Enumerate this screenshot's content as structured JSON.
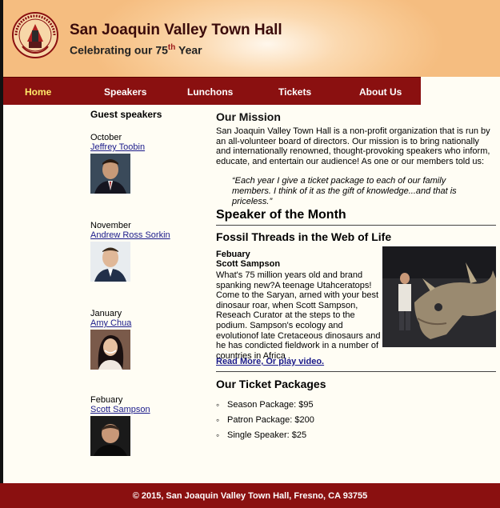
{
  "header": {
    "title": "San Joaquin Valley Town Hall",
    "tagline_prefix": "Celebrating our 75",
    "tagline_sup": "th",
    "tagline_suffix": " Year"
  },
  "nav": {
    "items": [
      "Home",
      "Speakers",
      "Lunchons",
      "Tickets",
      "About Us"
    ],
    "active": "Home"
  },
  "sidebar": {
    "title": "Guest speakers",
    "speakers": [
      {
        "month": "October",
        "name": "Jeffrey Toobin"
      },
      {
        "month": "November",
        "name": "Andrew Ross Sorkin"
      },
      {
        "month": "January",
        "name": "Amy Chua"
      },
      {
        "month": "Febuary",
        "name": "Scott Sampson"
      }
    ]
  },
  "main": {
    "mission_title": "Our Mission",
    "mission_text": "San Joaquin Valley Town Hall is a non-profit organization that is run by an all-volunteer board of directors. Our mission is to bring nationally and internationally renowned, thought-provoking speakers who inform, educate, and entertain our audience! As one or our members told us:",
    "quote": "“Each year I give a ticket package to each of our family members. I think of it as the gift of knowledge...and that is priceless.”",
    "som_title": "Speaker of the Month",
    "feature_title": "Fossil Threads in the Web of Life",
    "feature_month": "Febuary",
    "feature_name": "Scott Sampson",
    "feature_text": "What's 75 million years old and brand spanking new?A teenage Utahceratops! Come to the Saryan, arned with your best dinosaur roar, when Scott Sampson, Reseach Curator at the steps to the podium. Sampson's ecology and evolutionof late Cretaceous dinosaurs and he has condicted fieldwork in a number of countries in Africa .",
    "feature_link": "Read More, Or play video.",
    "tickets_title": "Our Ticket Packages",
    "tickets": [
      "Season Package: $95",
      "Patron Package: $200",
      "Single Speaker: $25"
    ]
  },
  "footer": {
    "text": "© 2015, San Joaquin Valley Town Hall, Fresno, CA 93755"
  },
  "colors": {
    "nav_bg": "#8a1010",
    "active_nav": "#ffea6a",
    "header_bg": "#f8c891",
    "link": "#1a1a8a"
  }
}
